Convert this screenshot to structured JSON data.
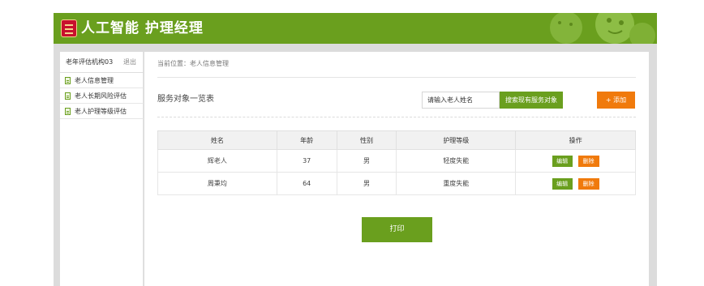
{
  "header": {
    "title": "人工智能 护理经理"
  },
  "sidebar": {
    "org_name": "老年评估机构03",
    "logout_label": "退出",
    "items": [
      {
        "label": "老人信息管理"
      },
      {
        "label": "老人长期风险评估"
      },
      {
        "label": "老人护理等级评估"
      }
    ]
  },
  "main": {
    "breadcrumb": "当前位置：老人信息管理",
    "list_title": "服务对象一览表",
    "search": {
      "placeholder": "请输入老人姓名"
    },
    "search_button": "搜索现有服务对象",
    "add_button": "+ 添加",
    "table": {
      "headers": [
        "姓名",
        "年龄",
        "性别",
        "护理等级",
        "操作"
      ],
      "rows": [
        {
          "name": "辉老人",
          "age": "37",
          "gender": "男",
          "level": "轻度失能"
        },
        {
          "name": "周秉均",
          "age": "64",
          "gender": "男",
          "level": "重度失能"
        }
      ],
      "edit_label": "编辑",
      "delete_label": "删除"
    },
    "print_button": "打印"
  },
  "colors": {
    "brand_green": "#6a9f1e",
    "accent_orange": "#f07a0c"
  }
}
